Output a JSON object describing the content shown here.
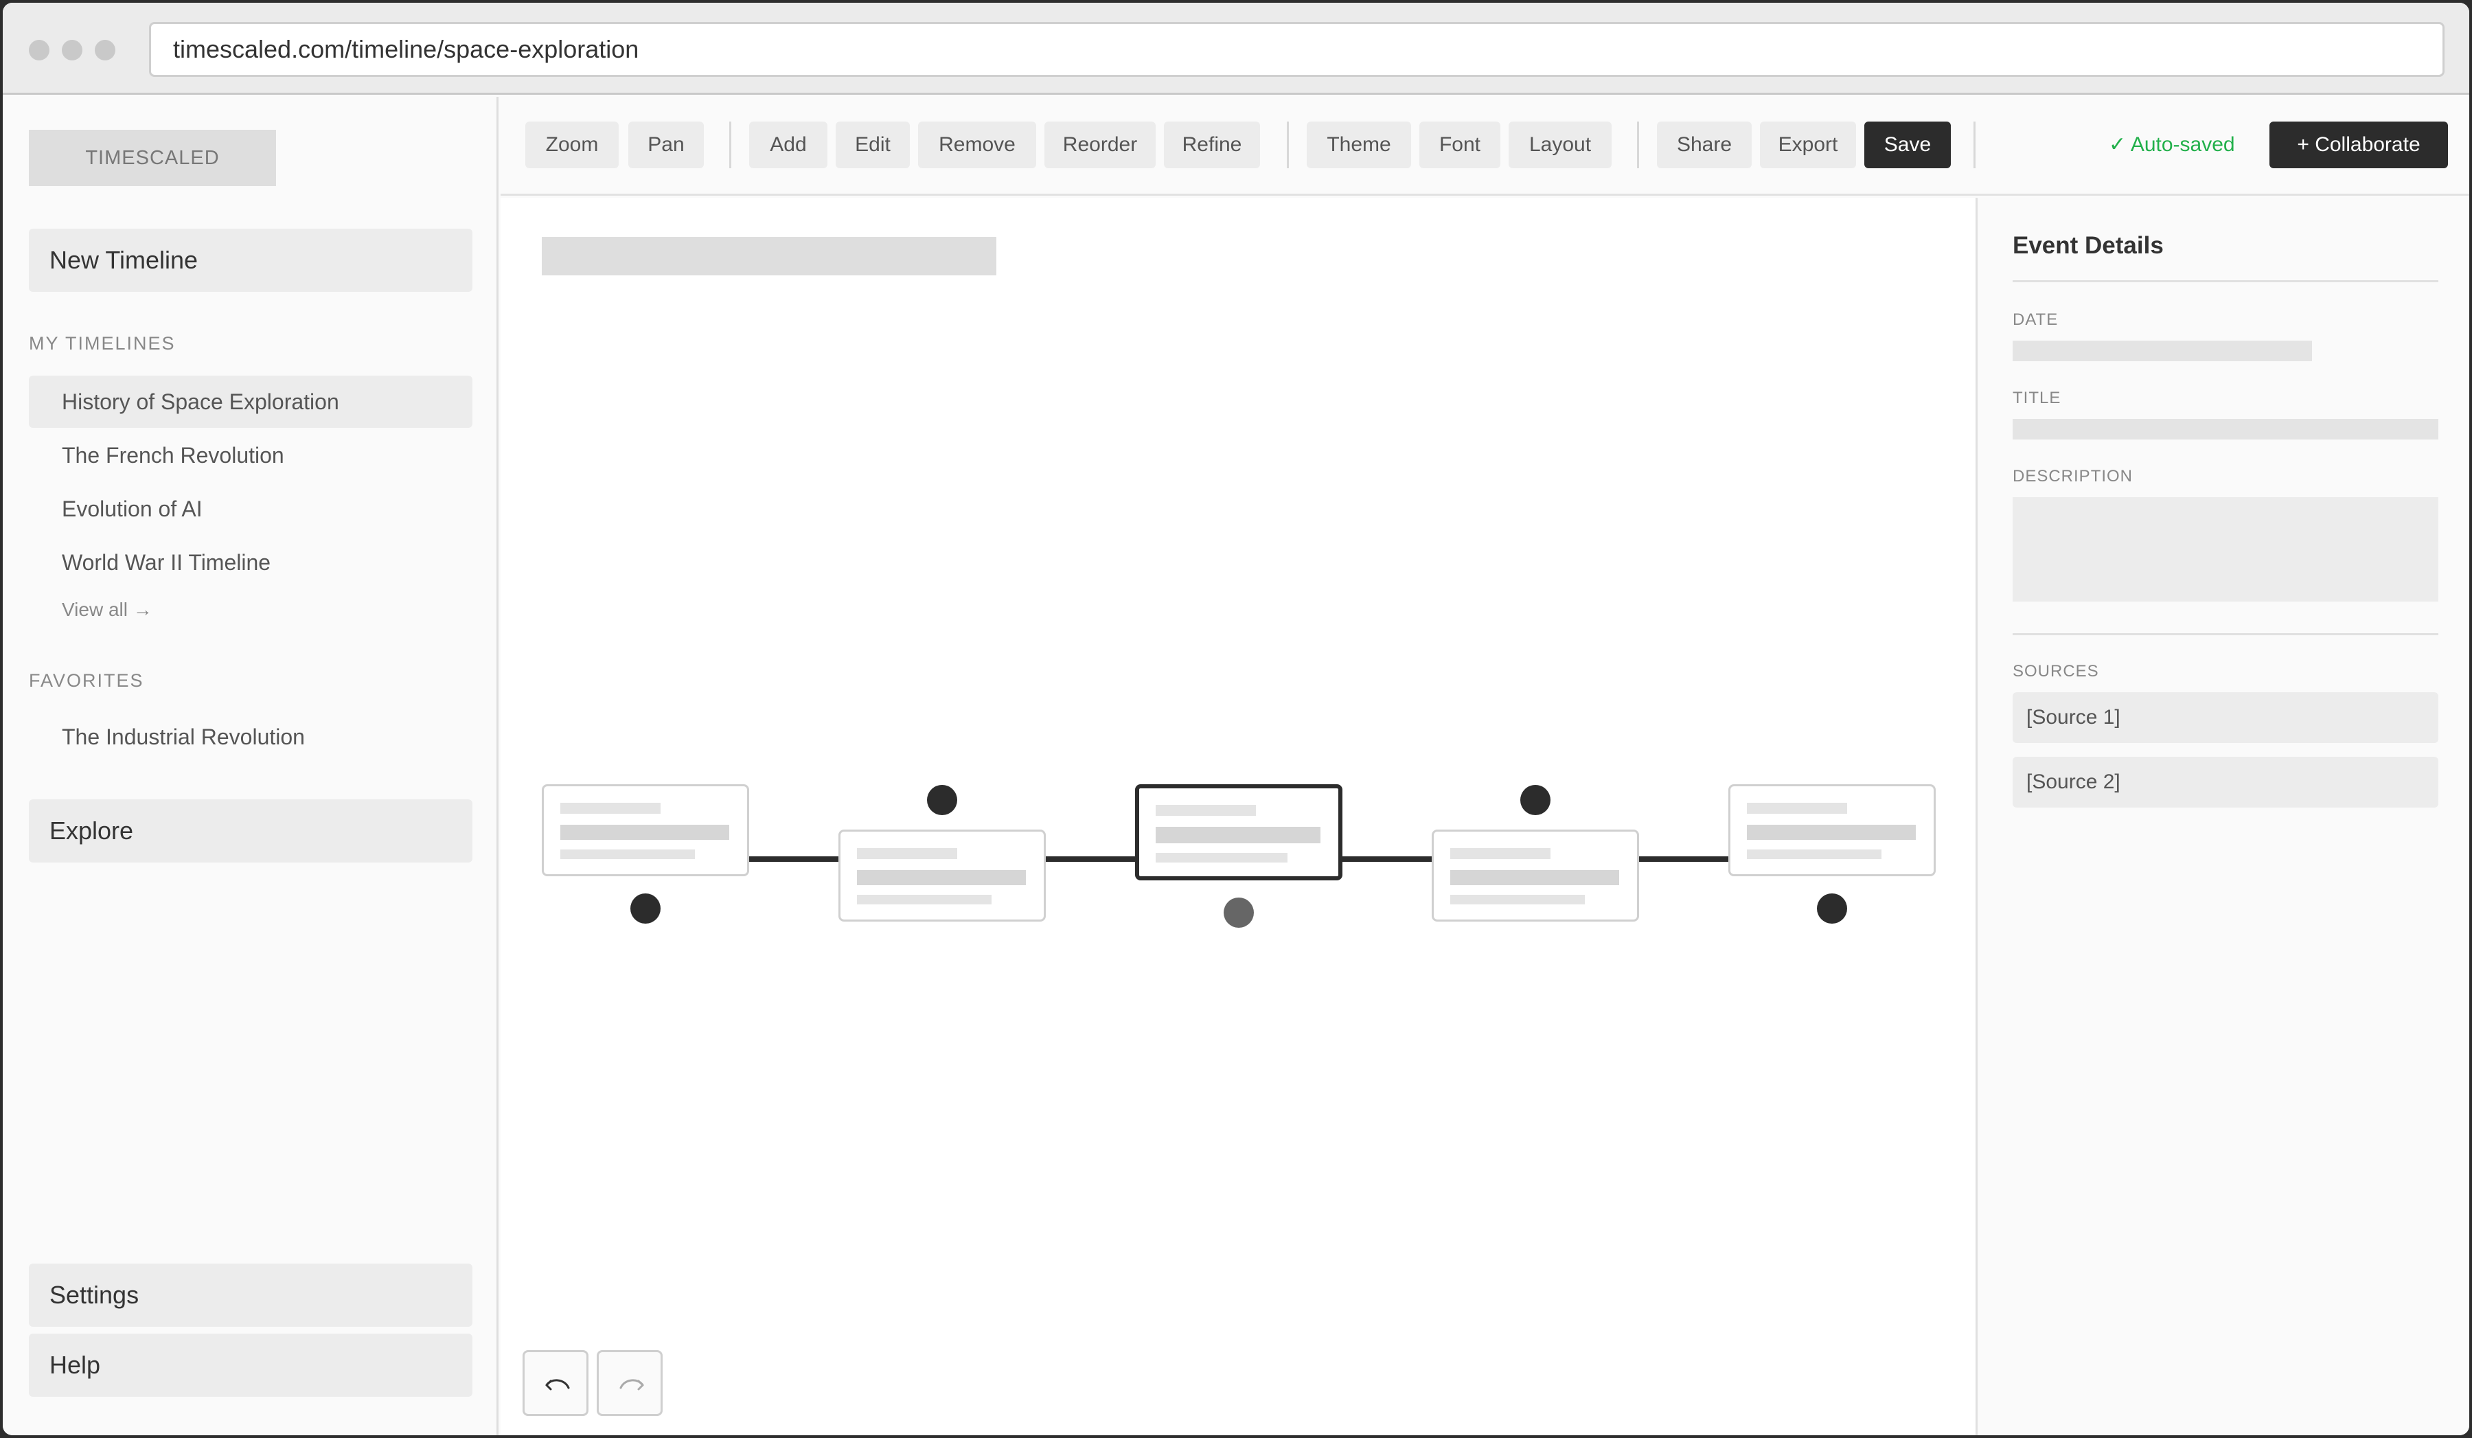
{
  "browser": {
    "url": "timescaled.com/timeline/space-exploration"
  },
  "sidebar": {
    "logo": "TIMESCALED",
    "new_timeline": "New Timeline",
    "my_timelines_label": "MY TIMELINES",
    "my_timelines": [
      {
        "label": "History of Space Exploration",
        "active": true
      },
      {
        "label": "The French Revolution",
        "active": false
      },
      {
        "label": "Evolution of AI",
        "active": false
      },
      {
        "label": "World War II Timeline",
        "active": false
      }
    ],
    "view_all": "View all →",
    "favorites_label": "FAVORITES",
    "favorites": [
      {
        "label": "The Industrial Revolution"
      }
    ],
    "explore": "Explore",
    "settings": "Settings",
    "help": "Help"
  },
  "toolbar": {
    "zoom": "Zoom",
    "pan": "Pan",
    "add": "Add",
    "edit": "Edit",
    "remove": "Remove",
    "reorder": "Reorder",
    "refine": "Refine",
    "theme": "Theme",
    "font": "Font",
    "layout": "Layout",
    "share": "Share",
    "export": "Export",
    "save": "Save",
    "autosaved": "✓ Auto-saved",
    "collaborate": "+ Collaborate"
  },
  "canvas": {
    "events_count_selected_index": 2,
    "icons": {
      "undo": "undo-icon",
      "redo": "redo-icon"
    }
  },
  "details": {
    "title": "Event Details",
    "date_label": "DATE",
    "title_label": "TITLE",
    "description_label": "DESCRIPTION",
    "sources_label": "SOURCES",
    "sources": [
      "[Source 1]",
      "[Source 2]"
    ]
  },
  "colors": {
    "accent_dark": "#2c2c2c",
    "autosaved_green": "#22b04b"
  }
}
